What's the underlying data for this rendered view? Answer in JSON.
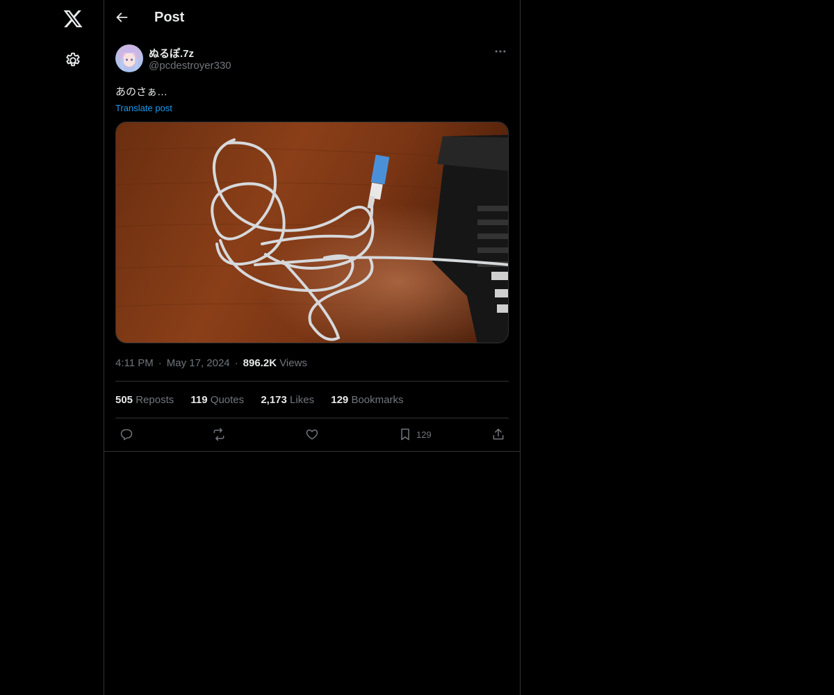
{
  "nav": {
    "logo": "x-logo-icon",
    "settings": "gear-icon"
  },
  "header": {
    "title": "Post",
    "back_icon": "arrow-left-icon"
  },
  "post": {
    "display_name": "ぬるぽ.7z",
    "handle": "@pcdestroyer330",
    "text": "あのさぁ…",
    "translate_label": "Translate post",
    "time": "4:11 PM",
    "date": "May 17, 2024",
    "views_count": "896.2K",
    "views_label": "Views",
    "stats": [
      {
        "count": "505",
        "label": "Reposts"
      },
      {
        "count": "119",
        "label": "Quotes"
      },
      {
        "count": "2,173",
        "label": "Likes"
      },
      {
        "count": "129",
        "label": "Bookmarks"
      }
    ],
    "actions": [
      {
        "icon": "reply-icon",
        "count": ""
      },
      {
        "icon": "repost-icon",
        "count": ""
      },
      {
        "icon": "like-icon",
        "count": ""
      },
      {
        "icon": "bookmark-icon",
        "count": "129"
      },
      {
        "icon": "share-icon",
        "count": ""
      }
    ]
  },
  "colors": {
    "background": "#000000",
    "text": "#e7e9ea",
    "secondary": "#71767b",
    "link": "#1d9bf0",
    "border": "#2f3336"
  }
}
